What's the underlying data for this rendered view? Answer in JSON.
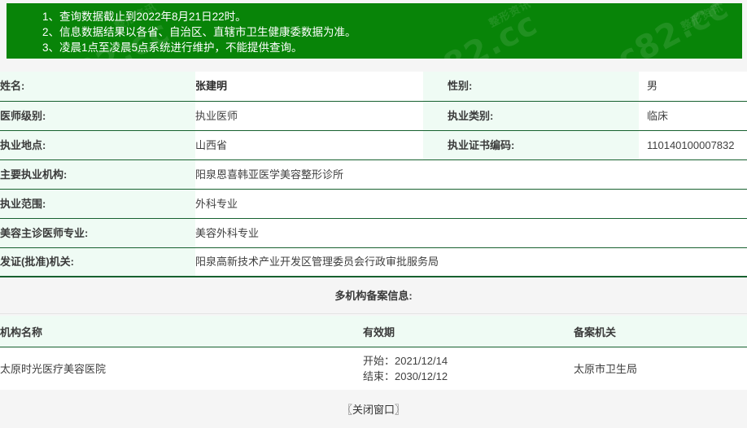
{
  "notice": {
    "lines": [
      "1、查询数据截止到2022年8月21日22时。",
      "2、信息数据结果以各省、自治区、直辖市卫生健康委数据为准。",
      "3、凌晨1点至凌晨5点系统进行维护，不能提供查询。"
    ],
    "watermark_text": "c82.cc",
    "watermark_small": "整形资讯",
    "background_color": "#088408"
  },
  "info": {
    "rows": [
      {
        "left_label": "姓名:",
        "left_value": "张建明",
        "right_label": "性别:",
        "right_value": "男"
      },
      {
        "left_label": "医师级别:",
        "left_value": "执业医师",
        "right_label": "执业类别:",
        "right_value": "临床"
      },
      {
        "left_label": "执业地点:",
        "left_value": "山西省",
        "right_label": "执业证书编码:",
        "right_value": "110140100007832"
      }
    ],
    "wide_rows": [
      {
        "label": "主要执业机构:",
        "value": "阳泉恩喜韩亚医学美容整形诊所"
      },
      {
        "label": "执业范围:",
        "value": "外科专业"
      },
      {
        "label": "美容主诊医师专业:",
        "value": "美容外科专业"
      },
      {
        "label": "发证(批准)机关:",
        "value": "阳泉高新技术产业开发区管理委员会行政审批服务局"
      }
    ]
  },
  "multi_section": {
    "title": "多机构备案信息:",
    "headers": [
      "机构名称",
      "有效期",
      "备案机关"
    ],
    "rows": [
      {
        "org_name": "太原时光医疗美容医院",
        "start_label": "开始：",
        "start_date": "2021/12/14",
        "end_label": "结束：",
        "end_date": "2030/12/12",
        "authority": "太原市卫生局"
      }
    ]
  },
  "footer": {
    "close_label": "〖关闭窗口〗"
  }
}
